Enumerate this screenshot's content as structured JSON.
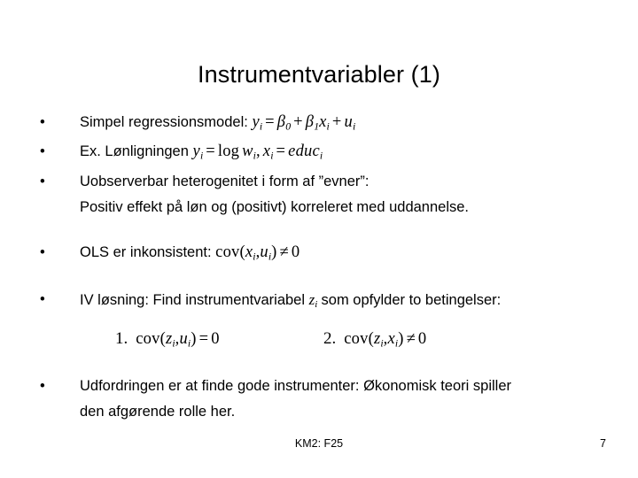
{
  "slide": {
    "title": "Instrumentvariabler (1)",
    "bullet_glyph": "•",
    "bullets": [
      {
        "text": "Simpel regressionsmodel:",
        "formula": "y_i = β_0 + β_1 x_i + u_i"
      },
      {
        "text": "Ex. Lønligningen",
        "formula": "y_i = log w_i , x_i = educ_i"
      },
      {
        "text": "Uobserverbar heterogenitet i form af ”evner”:",
        "subtext": "Positiv effekt på løn og (positivt) korreleret med uddannelse."
      },
      {
        "text": "OLS er inkonsistent:",
        "formula": "cov(x_i , u_i) ≠ 0"
      },
      {
        "text_before": "IV løsning: Find instrumentvariabel",
        "inline_symbol": "z_i",
        "text_after": "som opfylder to betingelser:"
      },
      {
        "text": "Udfordringen er at finde gode instrumenter: Økonomisk teori spiller",
        "subtext": "den afgørende rolle her."
      }
    ],
    "conditions": [
      {
        "number": "1.",
        "formula": "cov(z_i , u_i) = 0"
      },
      {
        "number": "2.",
        "formula": "cov(z_i , x_i) ≠ 0"
      }
    ],
    "math_tokens": {
      "y": "y",
      "x": "x",
      "u": "u",
      "z": "z",
      "w": "w",
      "beta": "β",
      "sub_i": "i",
      "sub_0": "0",
      "sub_1": "1",
      "eq": "=",
      "plus": "+",
      "neq": "≠",
      "zero": "0",
      "comma": ",",
      "log": "log",
      "cov": "cov",
      "educ": "educ",
      "lparen": "(",
      "rparen": ")"
    },
    "footer": {
      "course": "KM2: F25",
      "page_number": "7"
    }
  }
}
